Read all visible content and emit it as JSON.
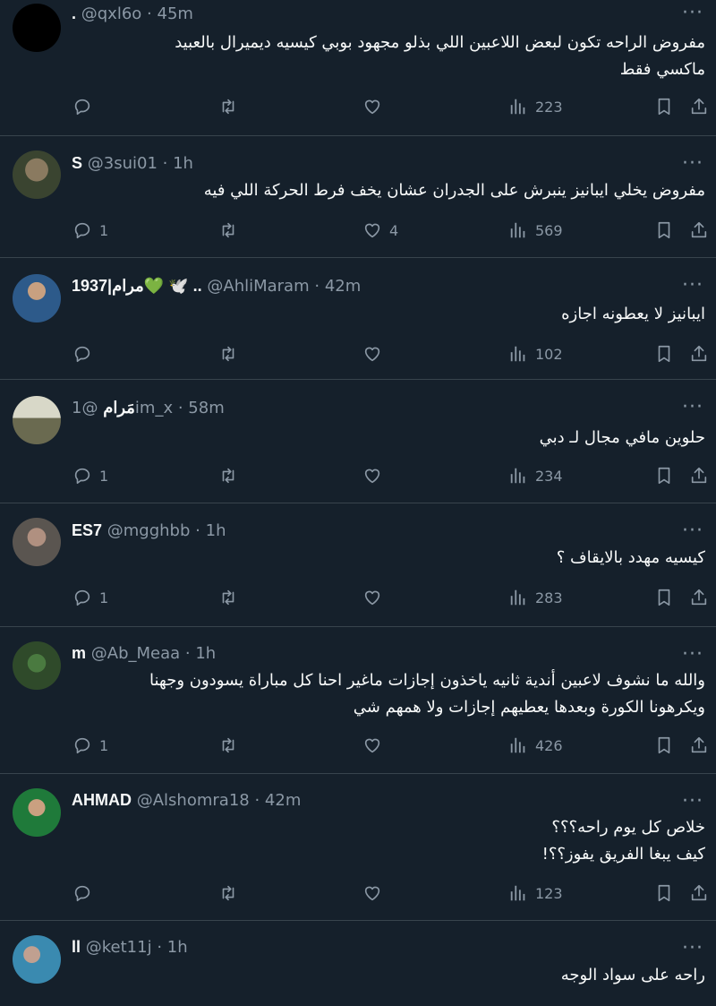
{
  "tweets": [
    {
      "name": ".",
      "handle": "@qxl6o",
      "time": "45m",
      "text": "مفروض الراحه تكون لبعض اللاعبين اللي بذلو مجهود بوبي كيسيه ديميرال بالعبيد\nماكسي فقط",
      "replies": "",
      "likes": "",
      "views": "223",
      "avatar_color": "#000000"
    },
    {
      "name": "S",
      "handle": "@3sui01",
      "time": "1h",
      "text": "مفروض يخلي ايبانيز ينبرش على الجدران عشان يخف فرط الحركة اللي فيه",
      "replies": "1",
      "likes": "4",
      "views": "569",
      "avatar_color": "#3a4430"
    },
    {
      "name": "1937|مرام💚 🕊️ ..",
      "handle": "@AhliMaram",
      "time": "42m",
      "text": "ايبانيز لا يعطونه اجازه",
      "replies": "",
      "likes": "",
      "views": "102",
      "avatar_color": "#2d5a8a"
    },
    {
      "name": "مَرام",
      "handle": "@1im_x",
      "time": "58m",
      "text": "حلوين مافي مجال لـ دبي",
      "replies": "1",
      "likes": "",
      "views": "234",
      "avatar_color": "#9aa08a"
    },
    {
      "name": "ES7",
      "handle": "@mgghbb",
      "time": "1h",
      "text": "كيسيه مهدد بالايقاف ؟",
      "replies": "1",
      "likes": "",
      "views": "283",
      "avatar_color": "#5a5550"
    },
    {
      "name": "m",
      "handle": "@Ab_Meaa",
      "time": "1h",
      "text": "والله ما نشوف لاعبين أندية ثانيه ياخذون إجازات ماغير احنا كل مباراة يسودون وجهنا\nويكرهونا الكورة وبعدها يعطيهم إجازات ولا همهم شي",
      "replies": "1",
      "likes": "",
      "views": "426",
      "avatar_color": "#2f4a2a"
    },
    {
      "name": "AHMAD",
      "handle": "@Alshomra18",
      "time": "42m",
      "text": "خلاص كل يوم راحه؟؟؟\nكيف يبغا الفريق يفوز؟؟!",
      "replies": "",
      "likes": "",
      "views": "123",
      "avatar_color": "#1f7a3a"
    },
    {
      "name": "ll",
      "handle": "@ket11j",
      "time": "1h",
      "text": "راحه على سواد الوجه",
      "replies": "",
      "likes": "",
      "views": "",
      "avatar_color": "#3a8ab0"
    }
  ]
}
